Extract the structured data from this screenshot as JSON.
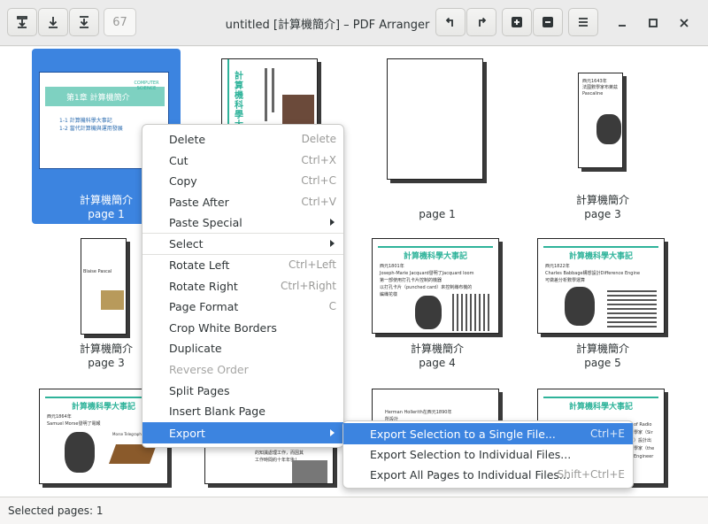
{
  "window": {
    "title": "untitled [計算機簡介] – PDF Arranger",
    "page_number": "67"
  },
  "pages": [
    {
      "name": "計算機簡介",
      "page": "page 1",
      "heading": "第1章 計算機簡介",
      "lines": [
        "1-1 計算機科學大事記",
        "1-2 當代計算機與運用發展"
      ],
      "tag": "COMPUTER SCIENCE"
    },
    {
      "name": "",
      "page": "",
      "heading": "計算機科學大事記",
      "lines": []
    },
    {
      "name": "",
      "page": "page 1",
      "heading": "",
      "lines": []
    },
    {
      "name": "計算機簡介",
      "page": "page 3",
      "heading": "",
      "lines": [
        "西元1643年",
        "法國數學家布萊茲",
        "Pascaline"
      ]
    },
    {
      "name": "計算機簡介",
      "page": "page 3",
      "heading": "",
      "lines": [
        "Blaise Pascal"
      ]
    },
    {
      "name": "計算機簡介",
      "page": "page 4",
      "heading": "計算機科學大事記",
      "lines": [
        "西元1801年",
        "Joseph-Marie Jacquard發明了Jacquard loom",
        "第一部使用打孔卡片控制的機器",
        "以打孔卡片（punched card）來控制織布機的",
        "編織花樣"
      ]
    },
    {
      "name": "計算機簡介",
      "page": "page 5",
      "heading": "計算機科學大事記",
      "lines": [
        "西元1822年",
        "Charles Babbage構想設計Difference Engine",
        "可做差分析數學運算"
      ]
    },
    {
      "name": "",
      "page": "",
      "heading": "計算機科學大事記",
      "lines": [
        "西元1864年",
        "Samuel Morse發明了電報"
      ],
      "tag": "Morse Telegraph Key"
    },
    {
      "name": "",
      "page": "",
      "heading": "",
      "lines": [
        "的知識處理工作，而因其",
        "工作時間約十年年後！"
      ]
    },
    {
      "name": "",
      "page": "",
      "heading": "",
      "lines": [
        "Herman Hollerith在西元1890年",
        "所設計"
      ]
    },
    {
      "name": "",
      "page": "",
      "heading": "計算機科學大事記",
      "lines": [
        "of Radio",
        "學家（Sir",
        "）設計出",
        "學家（the",
        "Engineer"
      ]
    }
  ],
  "context_menu": {
    "items": [
      {
        "label": "Delete",
        "accel": "Delete"
      },
      {
        "label": "Cut",
        "accel": "Ctrl+X"
      },
      {
        "label": "Copy",
        "accel": "Ctrl+C"
      },
      {
        "label": "Paste After",
        "accel": "Ctrl+V"
      },
      {
        "label": "Paste Special",
        "accel": ""
      },
      {
        "label": "Select",
        "accel": ""
      },
      {
        "label": "Rotate Left",
        "accel": "Ctrl+Left"
      },
      {
        "label": "Rotate Right",
        "accel": "Ctrl+Right"
      },
      {
        "label": "Page Format",
        "accel": "C"
      },
      {
        "label": "Crop White Borders",
        "accel": ""
      },
      {
        "label": "Duplicate",
        "accel": ""
      },
      {
        "label": "Reverse Order",
        "accel": ""
      },
      {
        "label": "Split Pages",
        "accel": ""
      },
      {
        "label": "Insert Blank Page",
        "accel": ""
      },
      {
        "label": "Export",
        "accel": ""
      }
    ]
  },
  "export_submenu": {
    "items": [
      {
        "label": "Export Selection to a Single File...",
        "accel": "Ctrl+E"
      },
      {
        "label": "Export Selection to Individual Files...",
        "accel": ""
      },
      {
        "label": "Export All Pages to Individual Files...",
        "accel": "Shift+Ctrl+E"
      }
    ]
  },
  "status": {
    "text": "Selected pages: 1"
  },
  "colors": {
    "accent": "#3c84e0",
    "slide_green": "#2fb39a"
  },
  "icons": {
    "save": "save-icon",
    "save_as": "download-icon",
    "export": "export-icon",
    "rotate_left": "rotate-left-icon",
    "rotate_right": "rotate-right-icon",
    "zoom_in": "zoom-in-icon",
    "zoom_out": "zoom-out-icon",
    "menu": "hamburger-menu-icon",
    "minimize": "minimize-icon",
    "maximize": "maximize-icon",
    "close": "close-icon"
  }
}
